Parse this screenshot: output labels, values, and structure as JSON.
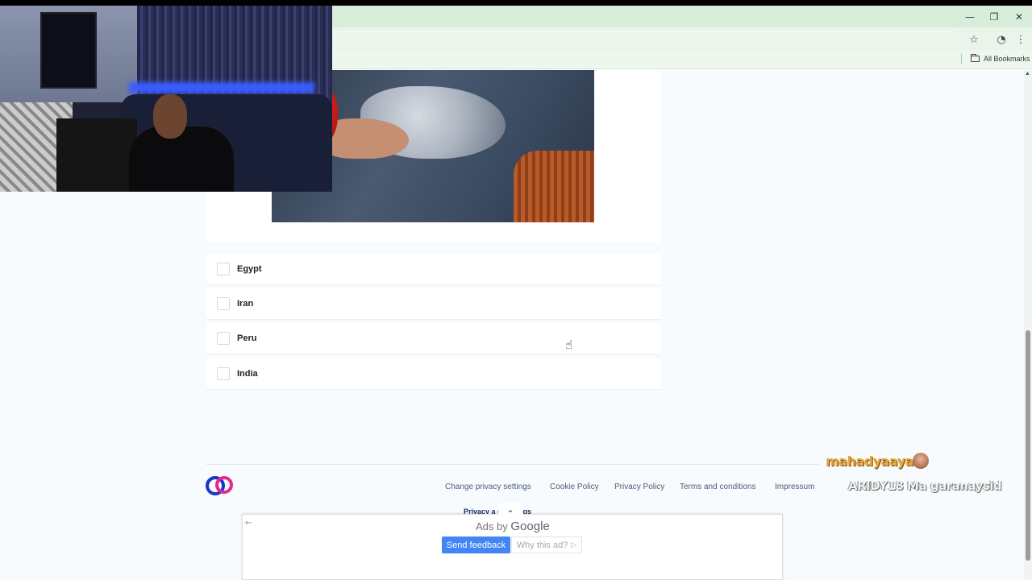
{
  "browser": {
    "bookmarks_all": "All Bookmarks",
    "controls": {
      "minimize": "—",
      "restore": "❐",
      "close": "✕"
    },
    "icons": {
      "star": "star-icon",
      "extension": "extension-icon",
      "menu": "kebab-menu-icon"
    }
  },
  "quiz": {
    "options": [
      "Egypt",
      "Iran",
      "Peru",
      "India"
    ]
  },
  "footer": {
    "links": {
      "change_privacy": "Change privacy settings",
      "cookie": "Cookie Policy",
      "privacy": "Privacy Policy",
      "terms": "Terms and conditions",
      "impressum": "Impressum"
    },
    "privacy_settings_line": "Privacy a        e settings"
  },
  "ad": {
    "ads_by": "Ads by",
    "google": "Google",
    "send_feedback": "Send feedback",
    "why_this_ad": "Why this ad?"
  },
  "stream_chat": {
    "line1": "mahadyaaya",
    "line2": "ARIDY18 Ma garanaysid"
  },
  "colors": {
    "feedback_button": "#4285f4",
    "chat_name": "#e9a63a",
    "logo_blue": "#1f35c9",
    "logo_pink": "#e5288b"
  }
}
